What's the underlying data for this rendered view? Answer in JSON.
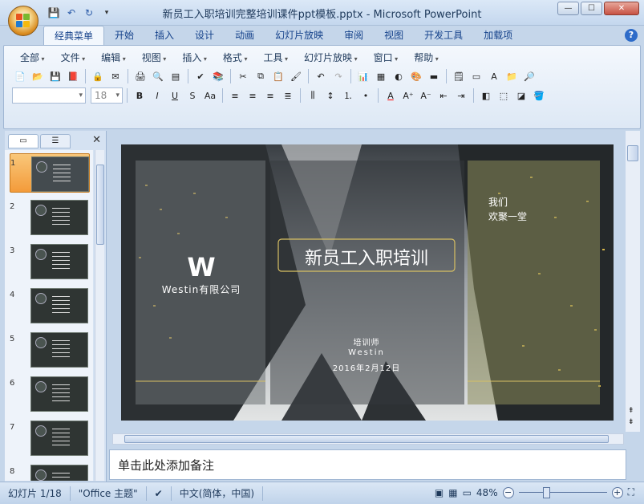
{
  "window": {
    "title": "新员工入职培训完整培训课件ppt模板.pptx - Microsoft PowerPoint"
  },
  "ribbon_tabs": [
    "经典菜单",
    "开始",
    "插入",
    "设计",
    "动画",
    "幻灯片放映",
    "审阅",
    "视图",
    "开发工具",
    "加载项"
  ],
  "classic_menu": [
    "全部",
    "文件",
    "编辑",
    "视图",
    "插入",
    "格式",
    "工具",
    "幻灯片放映",
    "窗口",
    "帮助"
  ],
  "font_combo": {
    "font": "",
    "size": "18"
  },
  "slide": {
    "logo_letter": "W",
    "company": "Westin有限公司",
    "title": "新员工入职培训",
    "welcome_line1": "我们",
    "welcome_line2": "欢聚一堂",
    "trainer_label": "培训师",
    "trainer_name": "Westin",
    "date": "2016年2月12日"
  },
  "thumbnails": [
    "1",
    "2",
    "3",
    "4",
    "5",
    "6",
    "7",
    "8"
  ],
  "notes_placeholder": "单击此处添加备注",
  "status": {
    "slide_info": "幻灯片 1/18",
    "theme": "\"Office 主题\"",
    "language": "中文(简体，中国)",
    "zoom": "48%"
  },
  "colors": {
    "accent_gold": "#d8c063",
    "panel_gray": "#6e7275",
    "panel_olive": "#8b8a5a"
  }
}
